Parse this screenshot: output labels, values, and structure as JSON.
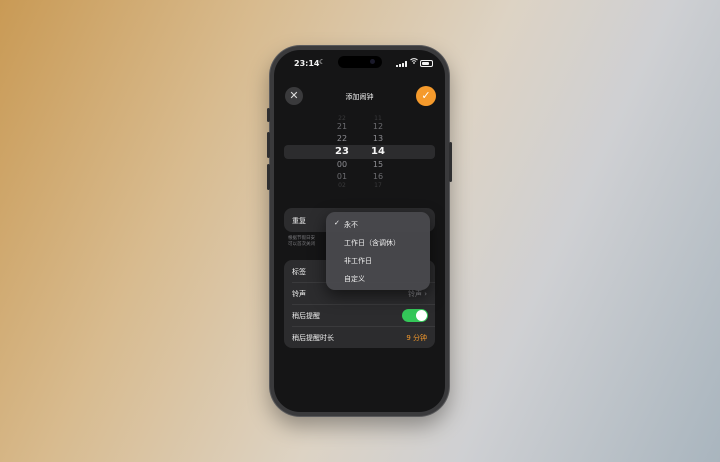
{
  "status_bar": {
    "time": "23:14",
    "moon_icon": "moon-icon",
    "battery_level": 0.75
  },
  "header": {
    "title": "添加闹钟",
    "close_icon": "close-icon",
    "confirm_icon": "check-icon"
  },
  "time_picker": {
    "hours": [
      "22",
      "21",
      "22",
      "23",
      "00",
      "01",
      "02"
    ],
    "minutes": [
      "11",
      "12",
      "13",
      "14",
      "15",
      "16",
      "17"
    ],
    "selected_hour": "23",
    "selected_minute": "14"
  },
  "repeat": {
    "label": "重复"
  },
  "footnote": {
    "line1": "根据节假日安",
    "line2": "可以首次关闭"
  },
  "settings": [
    {
      "label": "标签",
      "value": ""
    },
    {
      "label": "铃声",
      "value": "铃声"
    },
    {
      "label": "稍后提醒",
      "toggle_on": true
    },
    {
      "label": "稍后提醒时长",
      "value": "9 分钟"
    }
  ],
  "repeat_menu": {
    "options": [
      "永不",
      "工作日（含调休）",
      "非工作日",
      "自定义"
    ],
    "selected_index": 0
  },
  "colors": {
    "accent": "#f59a2c",
    "toggle_on": "#34c759",
    "background": "#151516",
    "card": "#2c2c2e"
  }
}
